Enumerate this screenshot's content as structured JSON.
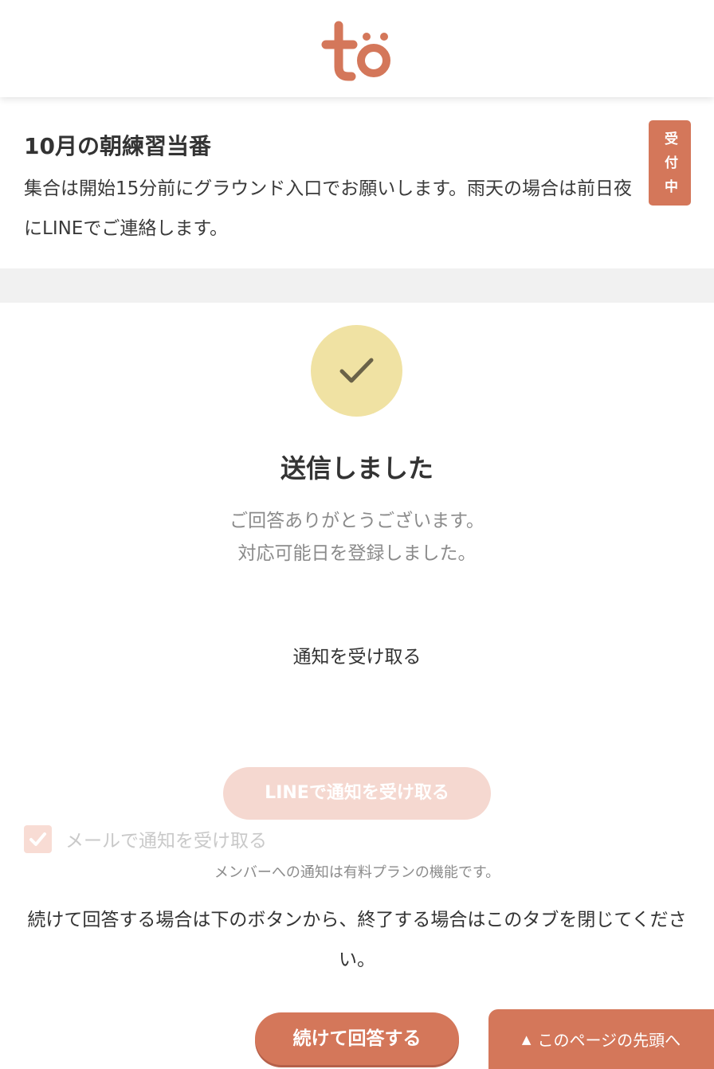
{
  "header": {
    "logo_text": "tö",
    "logo_icon": "to-logo-icon"
  },
  "event": {
    "title": "10月の朝練習当番",
    "description": "集合は開始15分前にグラウンド入口でお願いします。雨天の場合は前日夜にLINEでご連絡します。",
    "status_badge": "受付中"
  },
  "result": {
    "icon": "check-icon",
    "title": "送信しました",
    "message_line1": "ご回答ありがとうございます。",
    "message_line2": "対応可能日を登録しました。"
  },
  "notifications": {
    "heading": "通知を受け取る",
    "line_button_label": "LINEで通知を受け取る",
    "mail_label": "メールで通知を受け取る",
    "mail_checked": true,
    "plan_note": "メンバーへの通知は有料プランの機能です。"
  },
  "footer": {
    "continue_note": "続けて回答する場合は下のボタンから、終了する場合はこのタブを閉じてください。",
    "continue_button_label": "続けて回答する",
    "back_to_top_arrow": "▲",
    "back_to_top_label": "このページの先頭へ"
  },
  "colors": {
    "accent": "#d4775a",
    "accent_disabled": "#f5d8d0",
    "success_circle": "#f0e2a3",
    "band": "#f1f1f1"
  }
}
